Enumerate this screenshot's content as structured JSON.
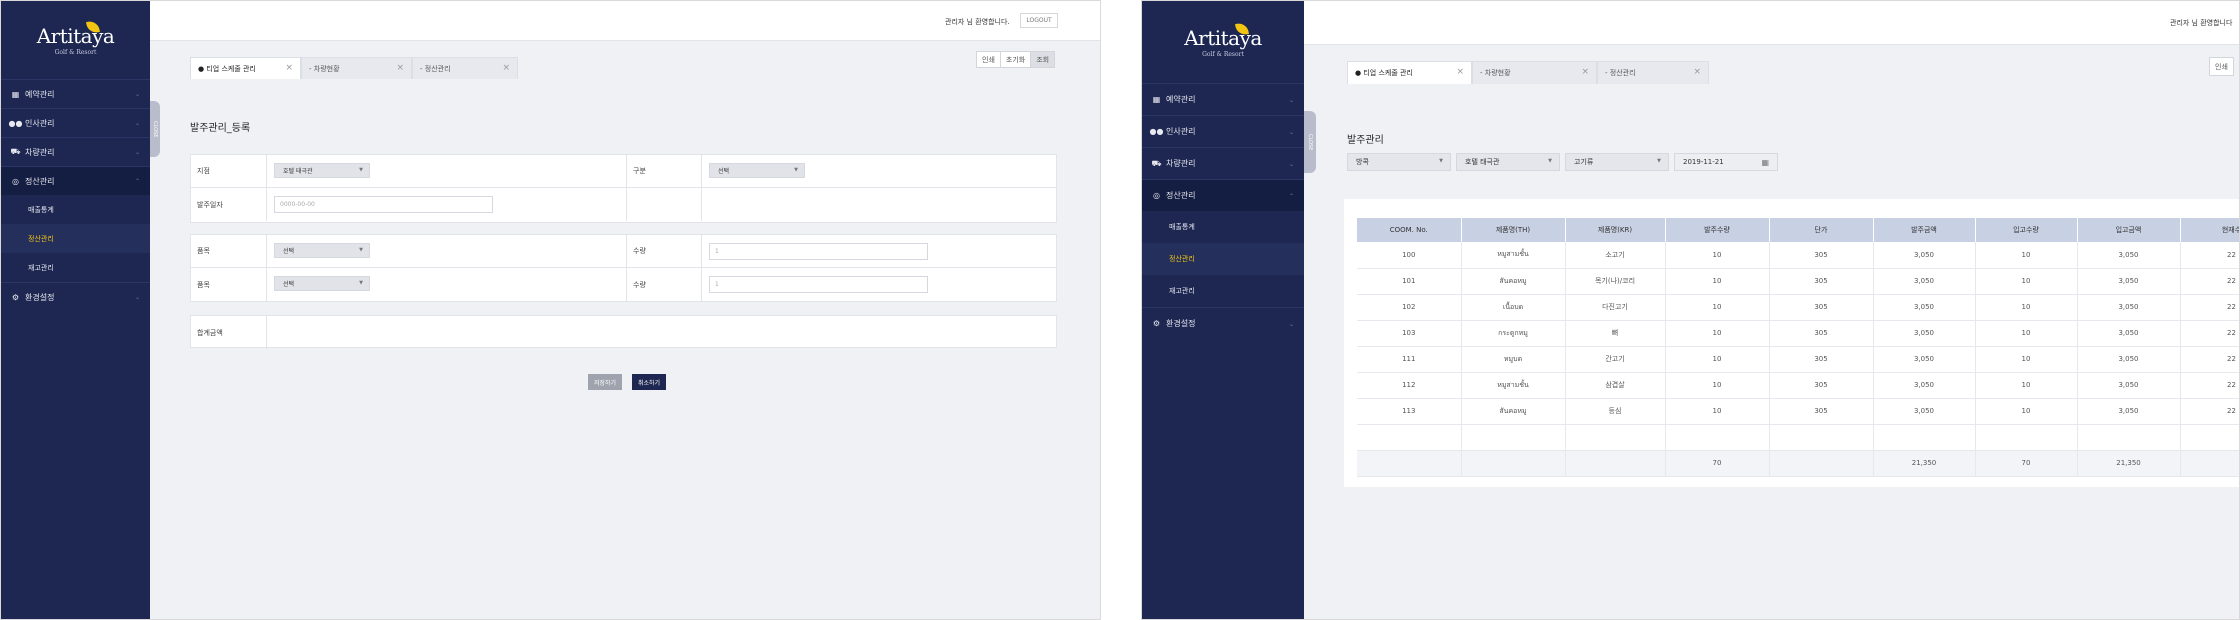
{
  "left": {
    "logo": {
      "word": "Artitaya",
      "sub": "Golf & Resort"
    },
    "welcome": "관리자 님 환영합니다.",
    "logout": "LOGOUT",
    "nav": {
      "items": [
        {
          "label": "예약관리",
          "icon": "calendar-icon"
        },
        {
          "label": "인사관리",
          "icon": "users-icon"
        },
        {
          "label": "차량관리",
          "icon": "car-icon"
        },
        {
          "label": "정산관리",
          "icon": "settlement-icon"
        },
        {
          "label": "환경설정",
          "icon": "gear-icon"
        }
      ],
      "sub": [
        "매출통계",
        "정산관리",
        "재고관리"
      ]
    },
    "tabs": [
      {
        "label": "● 티업 스케줄 관리"
      },
      {
        "label": "- 차량현황"
      },
      {
        "label": "- 정산관리"
      }
    ],
    "actions": {
      "print": "인쇄",
      "reset": "초기화",
      "search": "조회"
    },
    "close_handle": "CLOSE",
    "title": "발주관리_등록",
    "form": {
      "branch_label": "지점",
      "branch_value": "호텔 태극관",
      "type_label": "구분",
      "type_value": "선택",
      "date_label": "발주일자",
      "date_placeholder": "0000-00-00",
      "item_label": "품목",
      "item_value": "선택",
      "qty_label": "수량",
      "qty_placeholder": "1",
      "total_label": "합계금액"
    },
    "buttons": {
      "save": "저장하기",
      "cancel": "취소하기"
    }
  },
  "right": {
    "logo": {
      "word": "Artitaya",
      "sub": "Golf & Resort"
    },
    "welcome": "관리자 님 환영합니다",
    "nav": {
      "items": [
        {
          "label": "예약관리",
          "icon": "calendar-icon"
        },
        {
          "label": "인사관리",
          "icon": "users-icon"
        },
        {
          "label": "차량관리",
          "icon": "car-icon"
        },
        {
          "label": "정산관리",
          "icon": "settlement-icon"
        },
        {
          "label": "환경설정",
          "icon": "gear-icon"
        }
      ],
      "sub": [
        "매출통계",
        "정산관리",
        "재고관리"
      ]
    },
    "tabs": [
      {
        "label": "● 티업 스케줄 관리"
      },
      {
        "label": "- 차량현황"
      },
      {
        "label": "- 정산관리"
      }
    ],
    "actions": {
      "print": "인쇄"
    },
    "close_handle": "CLOSE",
    "title": "발주관리",
    "filters": {
      "f1": "방콕",
      "f2": "호텔 태극관",
      "f3": "고기류",
      "date": "2019-11-21"
    },
    "table": {
      "headers": [
        "COOM. No.",
        "제품명(TH)",
        "제품명(KR)",
        "발주수량",
        "단가",
        "발주금액",
        "입고수량",
        "입고금액",
        "현재수"
      ],
      "rows": [
        [
          "100",
          "หมูสามชั้น",
          "소고기",
          "10",
          "305",
          "3,050",
          "10",
          "3,050",
          "22"
        ],
        [
          "101",
          "สันคอหมู",
          "목기(나)/코리",
          "10",
          "305",
          "3,050",
          "10",
          "3,050",
          "22"
        ],
        [
          "102",
          "เนื้อบด",
          "다진고기",
          "10",
          "305",
          "3,050",
          "10",
          "3,050",
          "22"
        ],
        [
          "103",
          "กระดูกหมู",
          "뼈",
          "10",
          "305",
          "3,050",
          "10",
          "3,050",
          "22"
        ],
        [
          "111",
          "หมูบด",
          "간고기",
          "10",
          "305",
          "3,050",
          "10",
          "3,050",
          "22"
        ],
        [
          "112",
          "หมูสามชั้น",
          "삼겹살",
          "10",
          "305",
          "3,050",
          "10",
          "3,050",
          "22"
        ],
        [
          "113",
          "สันคอหมู",
          "등심",
          "10",
          "305",
          "3,050",
          "10",
          "3,050",
          "22"
        ]
      ],
      "totals": [
        "",
        "",
        "",
        "70",
        "",
        "21,350",
        "70",
        "21,350",
        ""
      ]
    }
  }
}
